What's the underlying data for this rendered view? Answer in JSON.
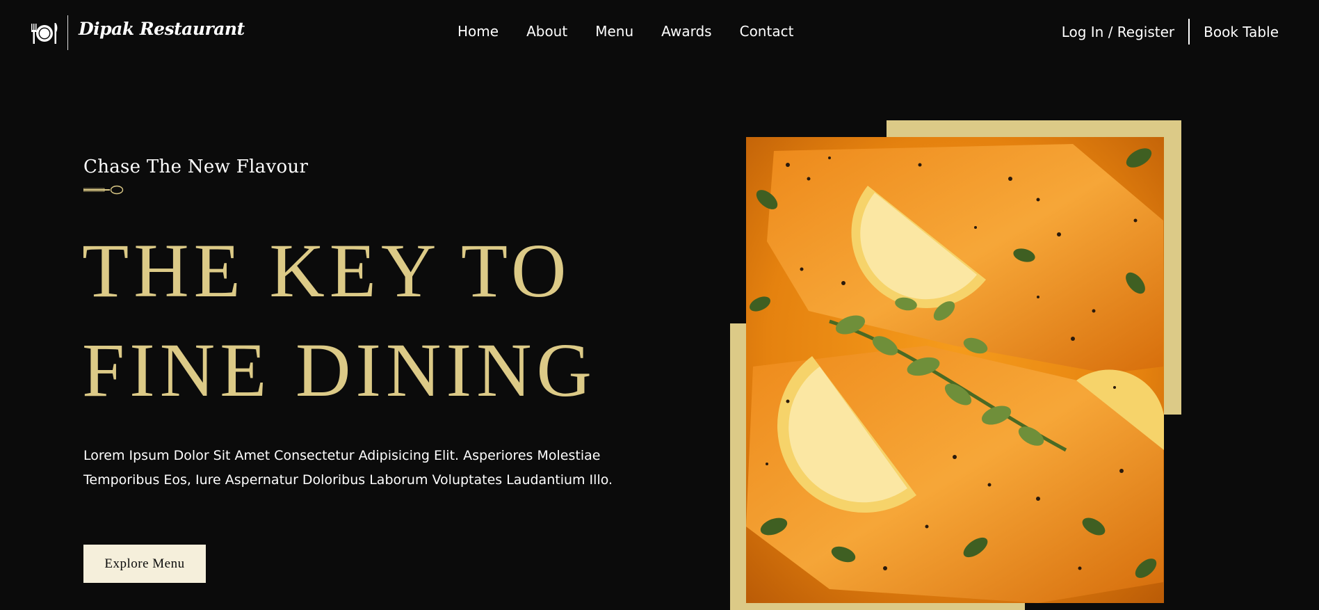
{
  "brand": {
    "name": "Dipak Restaurant",
    "logo_icon": "plate-cutlery-icon"
  },
  "nav": {
    "links": [
      "Home",
      "About",
      "Menu",
      "Awards",
      "Contact"
    ],
    "login_label": "Log In / Register",
    "book_label": "Book Table"
  },
  "hero": {
    "eyebrow": "Chase The New Flavour",
    "eyebrow_icon": "spoon-icon",
    "headline_line1": "THE KEY TO",
    "headline_line2": "FINE DINING",
    "description": "Lorem Ipsum Dolor Sit Amet Consectetur Adipisicing Elit. Asperiores Molestiae Temporibus Eos, Iure Aspernatur Doloribus Laborum Voluptates Laudantium Illo.",
    "cta_label": "Explore Menu",
    "image_subject": "salmon-with-lemon-and-herbs-image"
  },
  "colors": {
    "background": "#0b0b0b",
    "gold": "#dcca87",
    "cream": "#f5efdb",
    "text": "#ffffff"
  }
}
